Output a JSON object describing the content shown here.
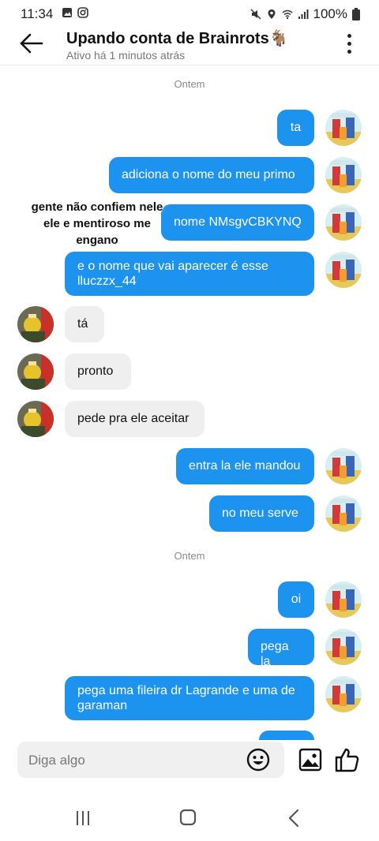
{
  "status": {
    "time": "11:34",
    "battery": "100%"
  },
  "header": {
    "title": "Upando conta de Brainrots🐐",
    "subtitle": "Ativo há 1 minutos atrás"
  },
  "separators": {
    "first": "Ontem",
    "second": "Ontem"
  },
  "messages": {
    "m1": "ta",
    "m2": "adiciona o nome do meu primo",
    "m3": "nome NMsgvCBKYNQ",
    "m4": "e o nome que vai aparecer é esse lluczzx_44",
    "m5": "tá",
    "m6": "pronto",
    "m7": "pede pra ele aceitar",
    "m8": "entra la ele mandou",
    "m9": "no meu serve",
    "m10": "oi",
    "m11": "pega la",
    "m12": "pega uma fileira dr Lagrande e uma de garaman"
  },
  "overlay_caption": "gente não confiem nele ele e mentiroso me engano",
  "input": {
    "placeholder": "Diga algo"
  },
  "colors": {
    "outgoing_bubble": "#1d93f0",
    "incoming_bubble": "#efefef",
    "text_muted": "#777777"
  },
  "icons": [
    "back-arrow-icon",
    "more-vert-icon",
    "emoji-icon",
    "image-icon",
    "like-icon",
    "nav-recents-icon",
    "nav-home-icon",
    "nav-back-icon"
  ]
}
